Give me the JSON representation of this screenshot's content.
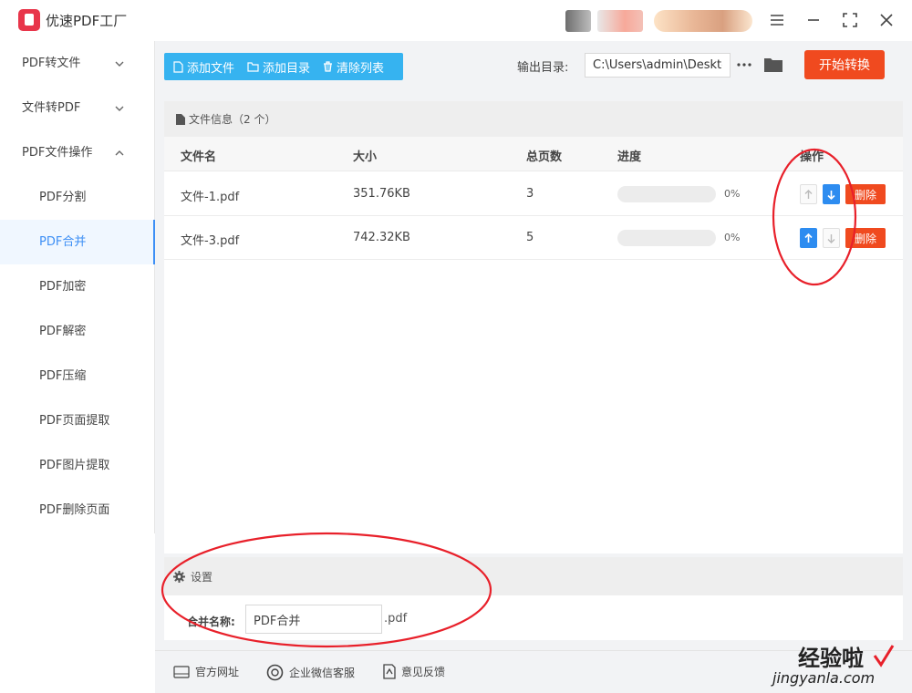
{
  "app": {
    "title": "优速PDF工厂"
  },
  "sidebar": {
    "items": [
      {
        "label": "PDF转文件",
        "kind": "group",
        "chevron": "down"
      },
      {
        "label": "文件转PDF",
        "kind": "group",
        "chevron": "down"
      },
      {
        "label": "PDF文件操作",
        "kind": "group",
        "chevron": "up"
      },
      {
        "label": "PDF分割",
        "kind": "sub"
      },
      {
        "label": "PDF合并",
        "kind": "sub",
        "active": true
      },
      {
        "label": "PDF加密",
        "kind": "sub"
      },
      {
        "label": "PDF解密",
        "kind": "sub"
      },
      {
        "label": "PDF压缩",
        "kind": "sub"
      },
      {
        "label": "PDF页面提取",
        "kind": "sub"
      },
      {
        "label": "PDF图片提取",
        "kind": "sub"
      },
      {
        "label": "PDF删除页面",
        "kind": "sub"
      }
    ]
  },
  "toolbar": {
    "add_file": "添加文件",
    "add_dir": "添加目录",
    "clear_list": "清除列表",
    "output_label": "输出目录:",
    "output_path": "C:\\Users\\admin\\Deskto",
    "start": "开始转换"
  },
  "files": {
    "header": "文件信息（2 个）",
    "columns": [
      "文件名",
      "大小",
      "总页数",
      "进度",
      "操作"
    ],
    "rows": [
      {
        "name": "文件-1.pdf",
        "size": "351.76KB",
        "pages": "3",
        "progress": 0,
        "progress_text": "0%",
        "up_enabled": false,
        "down_enabled": true,
        "delete": "删除"
      },
      {
        "name": "文件-3.pdf",
        "size": "742.32KB",
        "pages": "5",
        "progress": 0,
        "progress_text": "0%",
        "up_enabled": true,
        "down_enabled": false,
        "delete": "删除"
      }
    ]
  },
  "settings": {
    "title": "设置",
    "merge_label": "合并名称:",
    "merge_value": "PDF合并",
    "merge_ext": ".pdf"
  },
  "footer": {
    "website": "官方网址",
    "wechat": "企业微信客服",
    "feedback": "意见反馈"
  },
  "watermark": {
    "top": "经验啦",
    "bottom": "jingyanla.com"
  },
  "colors": {
    "accent_blue": "#3d8ff5",
    "toolbar_blue": "#36b3f0",
    "danger_orange": "#f04a1f",
    "annotation_red": "#e8202a"
  },
  "icons": {
    "window": [
      "menu-icon",
      "minimize-icon",
      "maximize-icon",
      "close-icon"
    ],
    "toolbar": [
      "file-icon",
      "folder-icon",
      "trash-icon",
      "ellipsis-icon",
      "folder-open-icon"
    ],
    "footer": [
      "globe-icon",
      "chat-icon",
      "feedback-icon"
    ]
  }
}
